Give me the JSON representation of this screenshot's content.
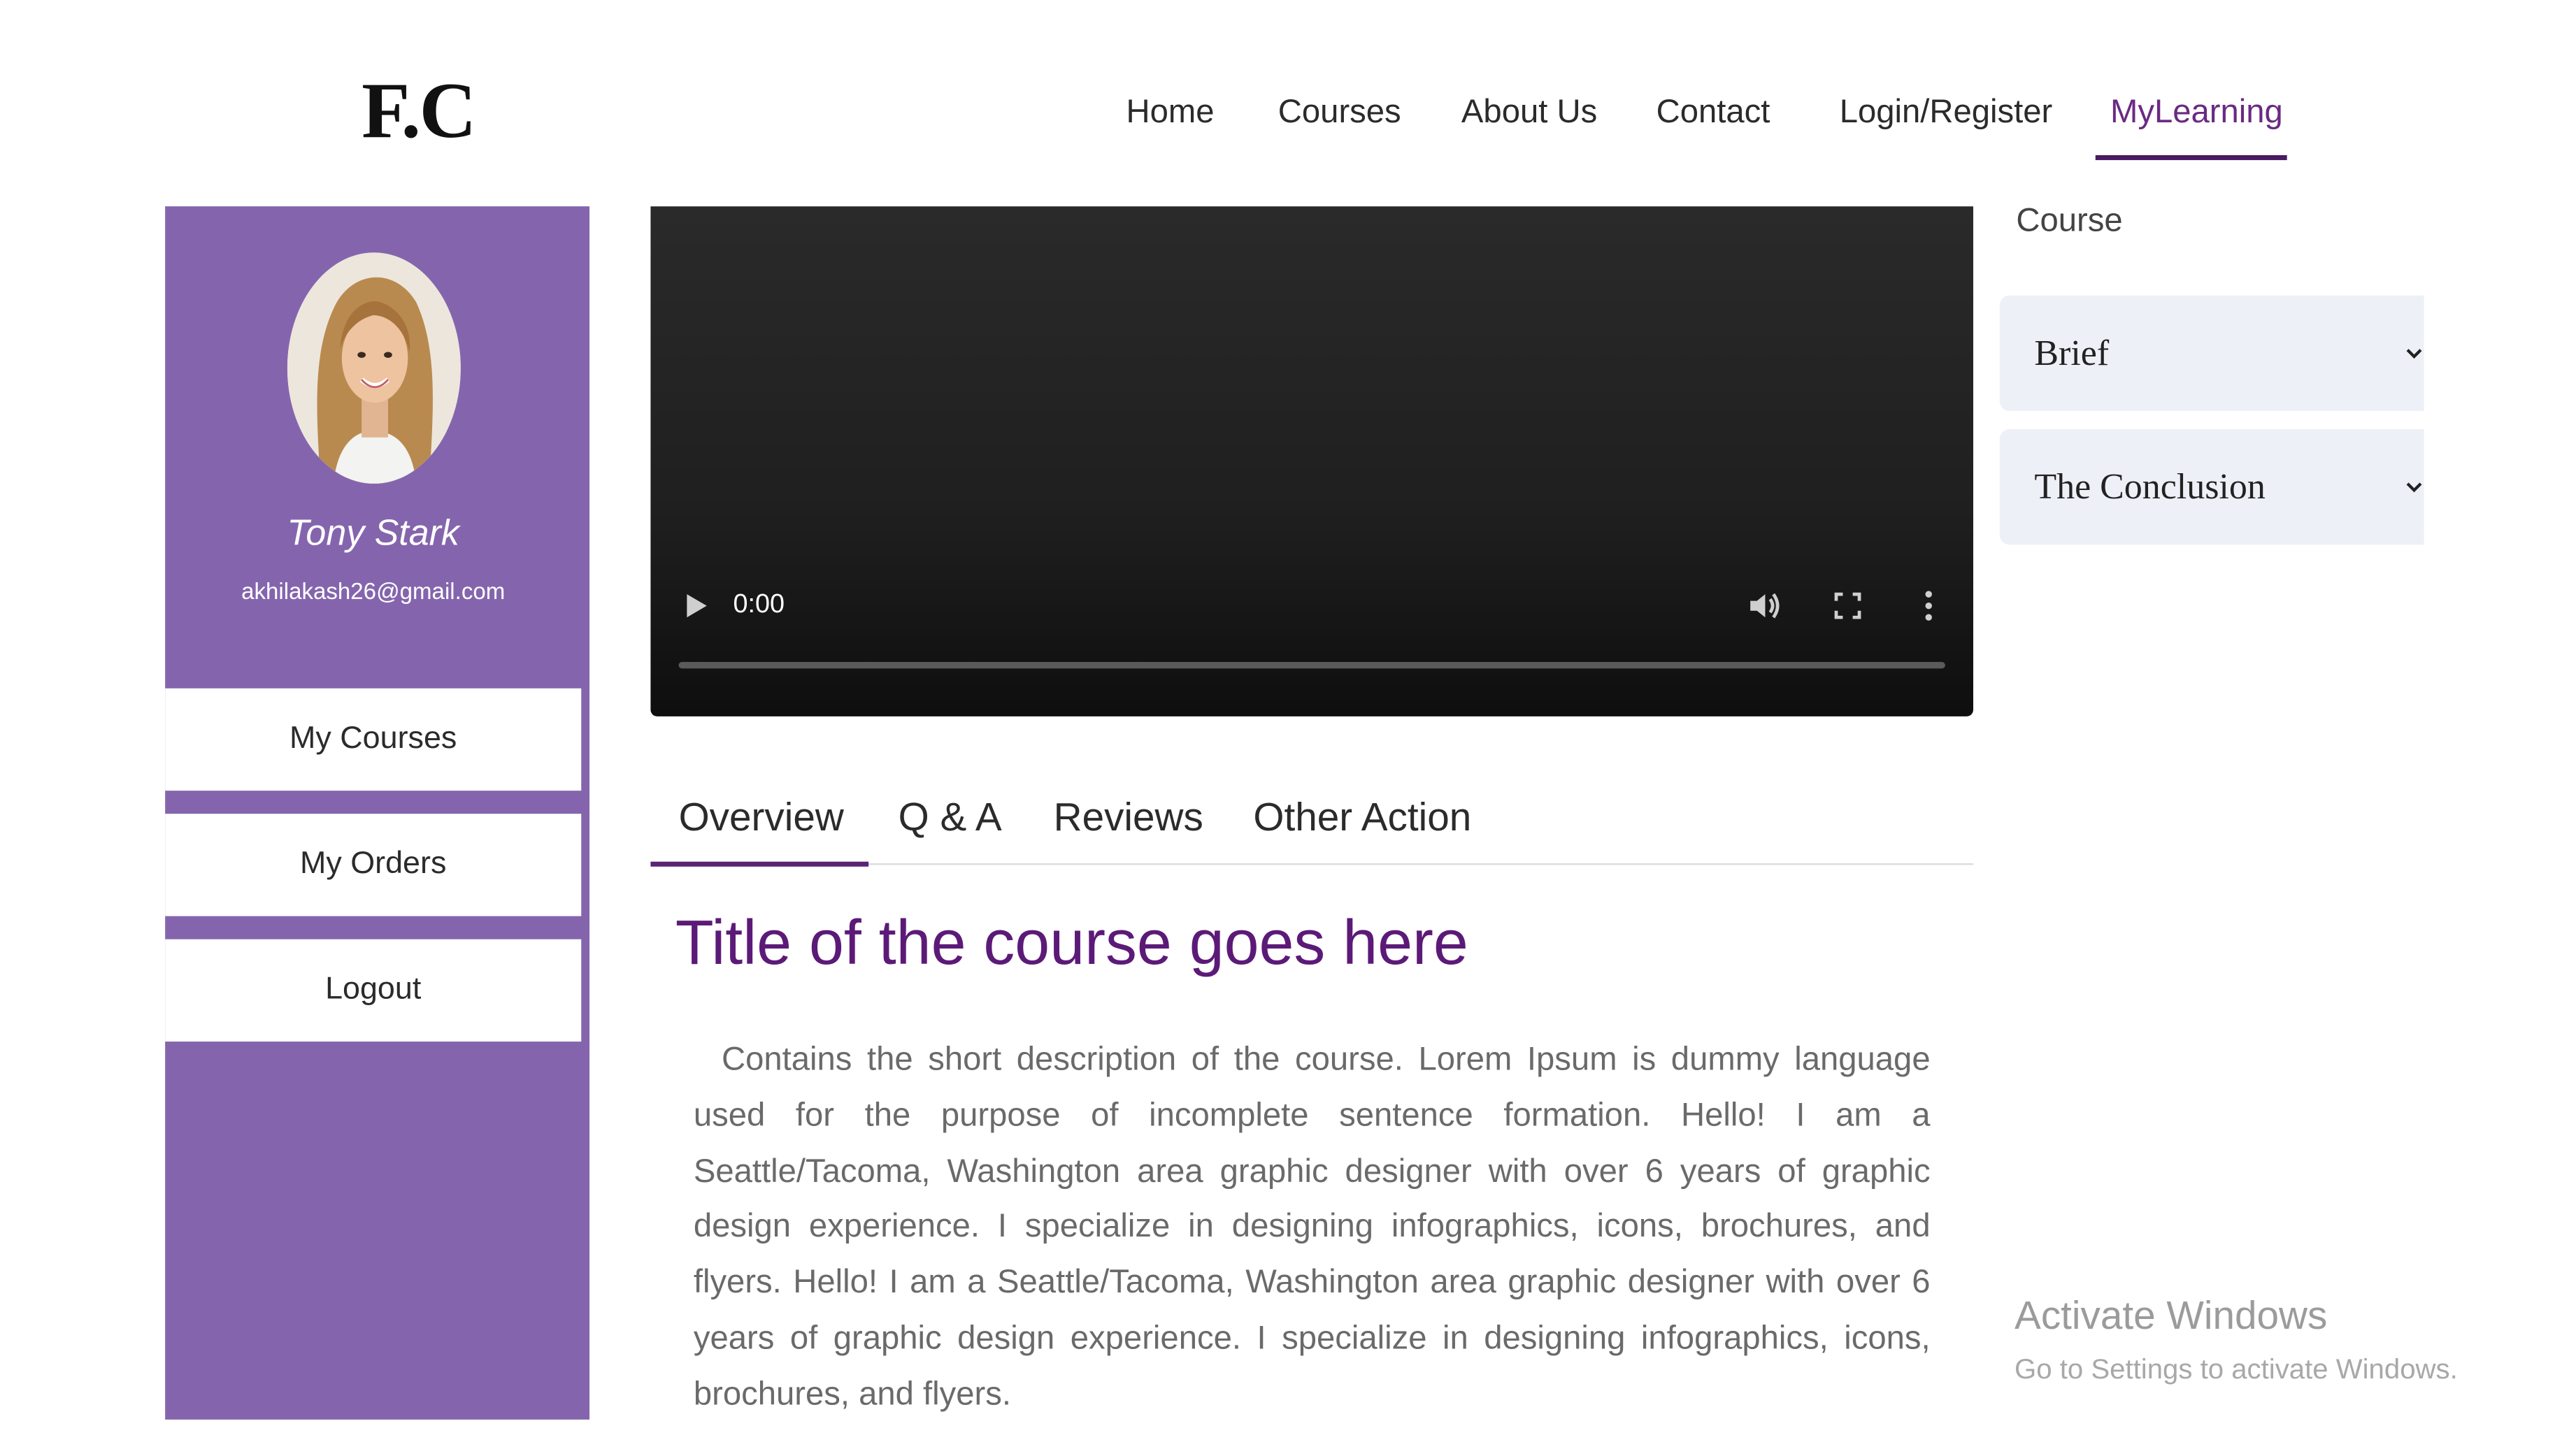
{
  "header": {
    "logo": "F.C",
    "nav": [
      {
        "label": "Home"
      },
      {
        "label": "Courses"
      },
      {
        "label": "About Us"
      },
      {
        "label": "Contact"
      },
      {
        "label": "Login/Register"
      },
      {
        "label": "MyLearning",
        "active": true
      }
    ]
  },
  "sidebar": {
    "name": "Tony Stark",
    "email": "akhilakash26@gmail.com",
    "buttons": [
      {
        "label": "My Courses"
      },
      {
        "label": "My Orders"
      },
      {
        "label": "Logout"
      }
    ]
  },
  "video": {
    "time": "0:00",
    "progress": 0,
    "icons": [
      "play-icon",
      "volume-icon",
      "fullscreen-icon",
      "more-vertical-icon"
    ]
  },
  "tabs": [
    {
      "label": "Overview",
      "active": true
    },
    {
      "label": "Q & A"
    },
    {
      "label": "Reviews"
    },
    {
      "label": "Other Action"
    }
  ],
  "course": {
    "title": "Title of the course goes here",
    "description": "Contains the short description of the course. Lorem Ipsum is dummy language used for the purpose of incomplete sentence formation. Hello! I am a Seattle/Tacoma, Washington area graphic designer with over 6 years of graphic design experience. I specialize in designing infographics, icons, brochures, and flyers. Hello! I am a Seattle/Tacoma, Washington area graphic designer with over 6 years of graphic design experience. I specialize in designing infographics, icons, brochures, and flyers."
  },
  "right_panel": {
    "label": "Course",
    "sections": [
      {
        "label": "Brief"
      },
      {
        "label": "The Conclusion"
      }
    ]
  },
  "watermark": {
    "title": "Activate Windows",
    "subtitle": "Go to Settings to activate Windows."
  },
  "colors": {
    "sidebar": "#8465ad",
    "accent": "#5c1a78",
    "nav_active": "#6a2a83",
    "accordion_bg": "#eef0f8"
  }
}
